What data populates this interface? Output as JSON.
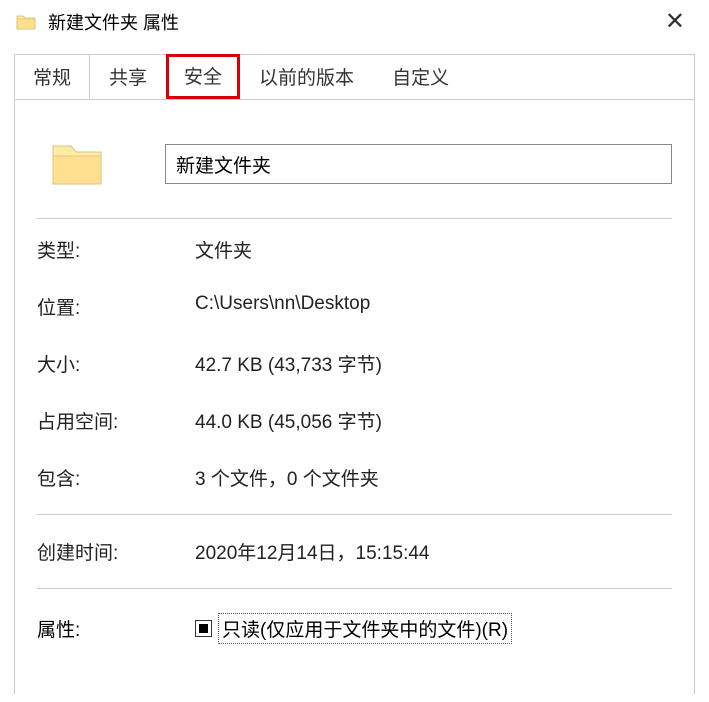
{
  "window": {
    "title": "新建文件夹 属性"
  },
  "tabs": {
    "general": "常规",
    "share": "共享",
    "security": "安全",
    "previous": "以前的版本",
    "custom": "自定义"
  },
  "folder": {
    "name": "新建文件夹"
  },
  "labels": {
    "type": "类型:",
    "location": "位置:",
    "size": "大小:",
    "diskSize": "占用空间:",
    "contains": "包含:",
    "created": "创建时间:",
    "attributes": "属性:"
  },
  "values": {
    "type": "文件夹",
    "location": "C:\\Users\\nn\\Desktop",
    "size": "42.7 KB (43,733 字节)",
    "diskSize": "44.0 KB (45,056 字节)",
    "contains": "3 个文件，0 个文件夹",
    "created": "2020年12月14日，15:15:44",
    "readonly": "只读(仅应用于文件夹中的文件)(R)"
  }
}
